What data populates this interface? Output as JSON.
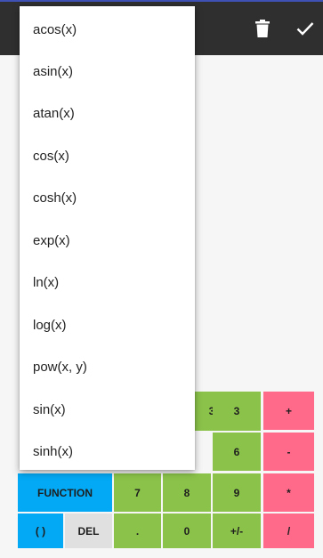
{
  "app_bar": {
    "icons": [
      "trash-icon",
      "check-icon"
    ],
    "background": "#2f2f2f"
  },
  "function_menu": {
    "items": [
      "acos(x)",
      "asin(x)",
      "atan(x)",
      "cos(x)",
      "cosh(x)",
      "exp(x)",
      "ln(x)",
      "log(x)",
      "pow(x, y)",
      "sin(x)",
      "sinh(x)"
    ]
  },
  "keypad": {
    "row1": [
      "3",
      "+"
    ],
    "row2": [
      "6",
      "-"
    ],
    "row3": [
      "FUNCTION",
      "7",
      "8",
      "9",
      "*"
    ],
    "row4": [
      "( )",
      "DEL",
      ".",
      "0",
      "+/-",
      "/"
    ]
  },
  "colors": {
    "number_keys": "#8bc34a",
    "operator_keys": "#ff6a8b",
    "function_keys": "#03a9f4",
    "del_key": "#e0e0e0"
  }
}
